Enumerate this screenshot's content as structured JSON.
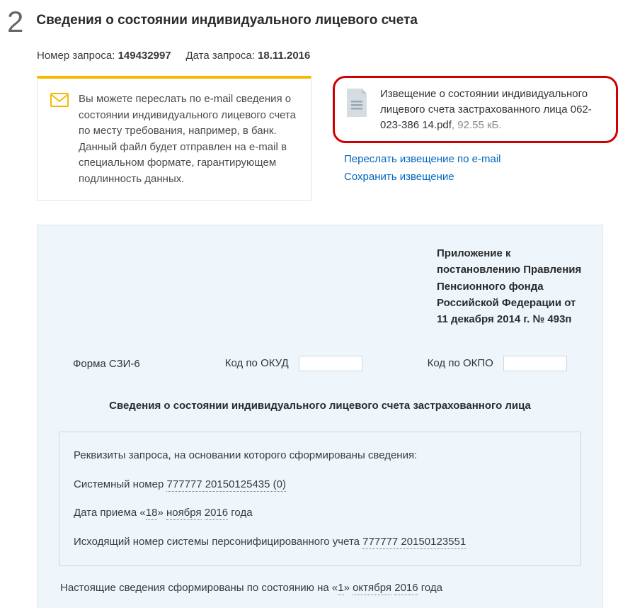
{
  "step": "2",
  "title": "Сведения о состоянии индивидуального лицевого счета",
  "meta": {
    "request_label": "Номер запроса:",
    "request_num": "149432997",
    "date_label": "Дата запроса:",
    "date_val": "18.11.2016"
  },
  "info_text": "Вы можете переслать по e-mail сведения о состоянии индивидуального лицевого счета по месту требования, например, в банк. Данный файл будет отправлен на e-mail в специальном формате, гарантирующем подлинность данных.",
  "file": {
    "name_prefix": "Извещение о состоянии индивидуального лицевого счета застрахованного лица 062-023-386 14.pdf",
    "size": ", 92.55 кБ."
  },
  "links": {
    "forward": "Переслать извещение по e-mail",
    "save": "Сохранить извещение"
  },
  "appendix": "Приложение к постановлению Правления Пенсионного фонда Российской Федерации от 11 декабря 2014 г. № 493п",
  "form_row": {
    "form_label": "Форма СЗИ-6",
    "okud": "Код по ОКУД",
    "okpo": "Код по ОКПО"
  },
  "doc_title": "Сведения о состоянии индивидуального лицевого счета застрахованного лица",
  "req": {
    "intro": "Реквизиты запроса, на основании которого сформированы сведения:",
    "sysnum_label": "Системный номер ",
    "sysnum_val": "777777 20150125435 (0)",
    "date_label_1": "Дата приема «",
    "date_day": "18",
    "date_mid": "»  ",
    "date_month": "ноября",
    "date_sep": "  ",
    "date_year": "2016",
    "date_tail": "  года",
    "outnum_label": "Исходящий номер системы персонифицированного учета ",
    "outnum_val": "777777 20150123551"
  },
  "status": {
    "prefix": "Настоящие сведения сформированы по состоянию на  «",
    "day": "1",
    "mid": "»  ",
    "month": "октября",
    "sep": "  ",
    "year": "2016",
    "tail": "  года"
  }
}
